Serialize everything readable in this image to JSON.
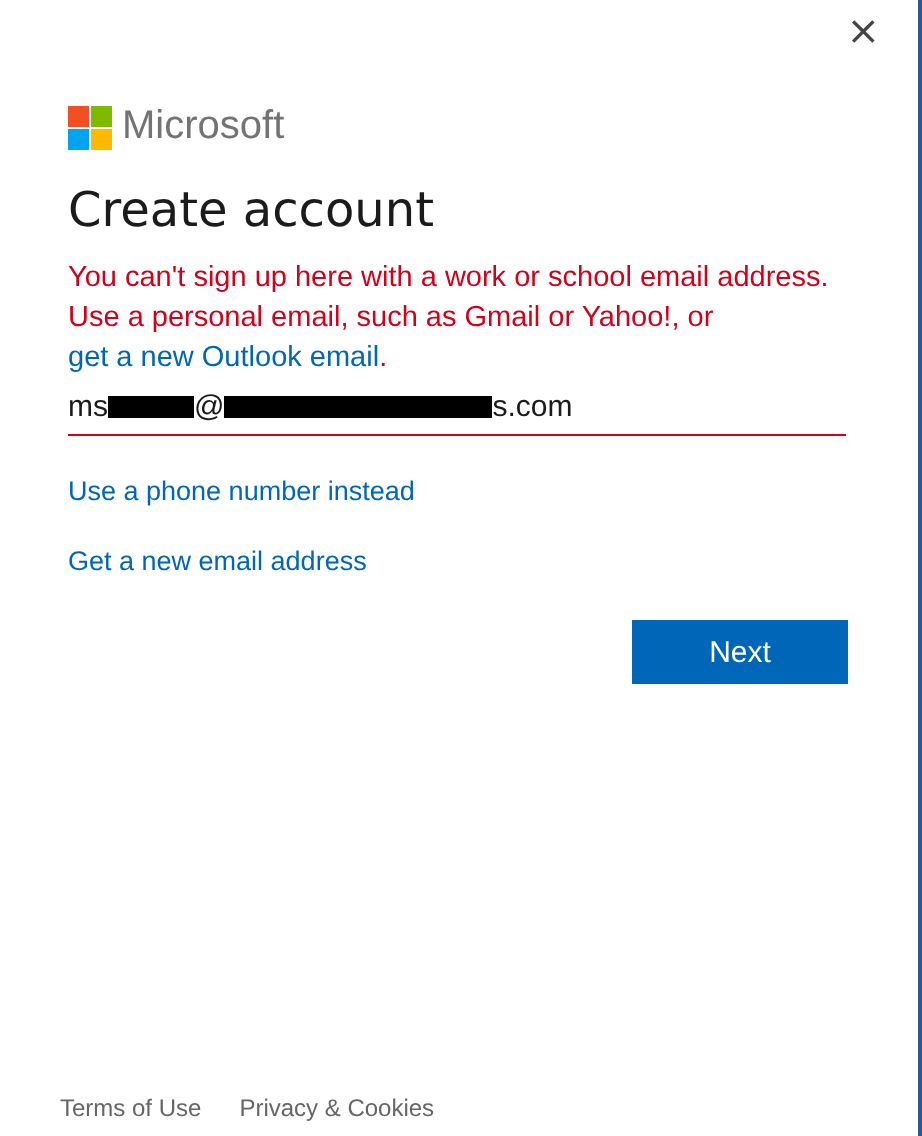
{
  "window": {
    "close": "×"
  },
  "brand": {
    "name": "Microsoft"
  },
  "title": "Create account",
  "error": {
    "text": "You can't sign up here with a work or school email address. Use a personal email, such as Gmail or Yahoo!, or",
    "link": "get a new Outlook email",
    "end": "."
  },
  "email": {
    "invalid": true,
    "parts": [
      {
        "kind": "text",
        "text": "ms"
      },
      {
        "kind": "redacted"
      },
      {
        "kind": "text",
        "text": "@"
      },
      {
        "kind": "redacted"
      },
      {
        "kind": "text",
        "text": "s.com"
      }
    ]
  },
  "links": [
    "Use a phone number instead",
    "Get a new email address"
  ],
  "button": "Next",
  "footer": [
    "Terms of Use",
    "Privacy & Cookies"
  ]
}
